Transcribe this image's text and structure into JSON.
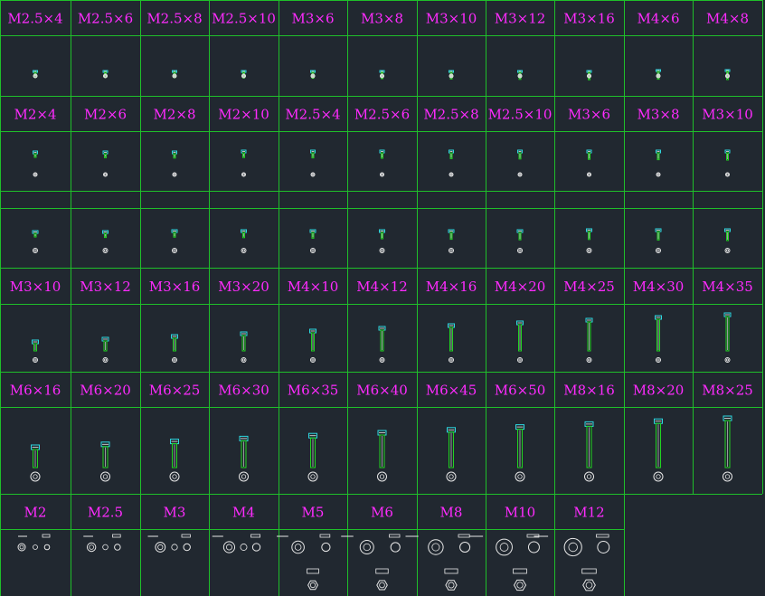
{
  "colors": {
    "background": "#212830",
    "grid": "#1fbf2a",
    "label": "#ff2bff",
    "bolt": "#21d321",
    "head": "#2dd8e0",
    "outline": "#e8e8e8"
  },
  "rows": [
    {
      "kind": "bolt",
      "labels": [
        "M2.5×4",
        "M2.5×6",
        "M2.5×8",
        "M2.5×10",
        "M3×6",
        "M3×8",
        "M3×10",
        "M3×12",
        "M3×16",
        "M4×6",
        "M4×8"
      ]
    },
    {
      "kind": "bolt",
      "labels": [
        "M2×4",
        "M2×6",
        "M2×8",
        "M2×10",
        "M2.5×4",
        "M2.5×6",
        "M2.5×8",
        "M2.5×10",
        "M3×6",
        "M3×8",
        "M3×10"
      ]
    },
    {
      "kind": "bolt",
      "labels": [
        "",
        "",
        "",
        "",
        "",
        "",
        "",
        "",
        "",
        "",
        ""
      ]
    },
    {
      "kind": "bolt",
      "labels": [
        "M3×10",
        "M3×12",
        "M3×16",
        "M3×20",
        "M4×10",
        "M4×12",
        "M4×16",
        "M4×20",
        "M4×25",
        "M4×30",
        "M4×35"
      ]
    },
    {
      "kind": "bolt",
      "labels": [
        "M6×16",
        "M6×20",
        "M6×25",
        "M6×30",
        "M6×35",
        "M6×40",
        "M6×45",
        "M6×50",
        "M8×16",
        "M8×20",
        "M8×25"
      ]
    },
    {
      "kind": "nut",
      "labels": [
        "M2",
        "M2.5",
        "M3",
        "M4",
        "M5",
        "M6",
        "M8",
        "M10",
        "M12"
      ]
    }
  ]
}
